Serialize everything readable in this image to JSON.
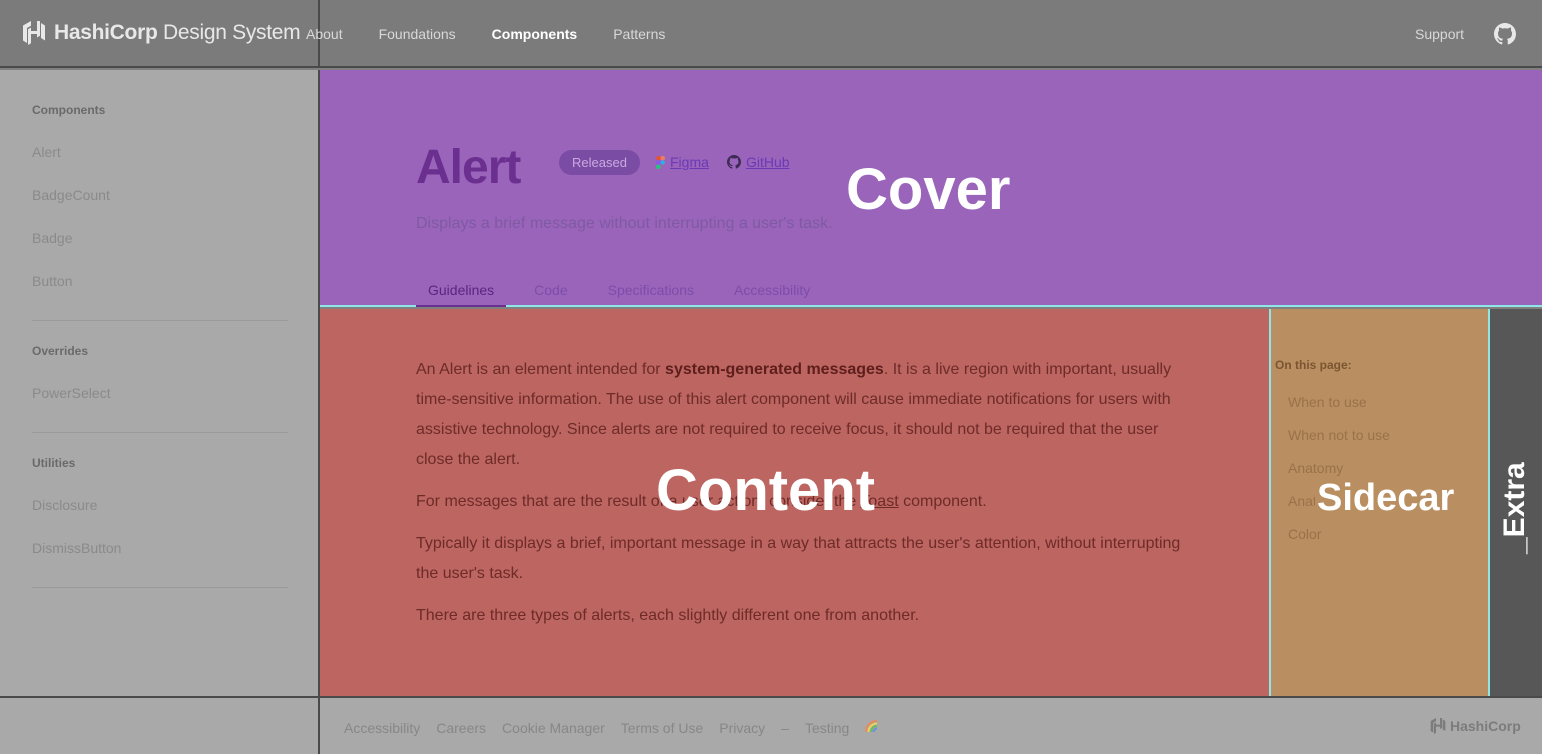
{
  "header": {
    "logo_brand": "HashiCorp",
    "logo_product": "Design System",
    "nav": [
      "About",
      "Foundations",
      "Components",
      "Patterns"
    ],
    "nav_active": "Components",
    "support": "Support"
  },
  "sidebar": {
    "sections": [
      {
        "title": "Components",
        "items": [
          "Alert",
          "BadgeCount",
          "Badge",
          "Button"
        ]
      },
      {
        "title": "Overrides",
        "items": [
          "PowerSelect"
        ]
      },
      {
        "title": "Utilities",
        "items": [
          "Disclosure",
          "DismissButton"
        ]
      }
    ]
  },
  "cover": {
    "title": "Alert",
    "badge": "Released",
    "figma": "Figma",
    "github": "GitHub",
    "subtitle": "Displays a brief message without interrupting a user's task.",
    "tabs": [
      "Guidelines",
      "Code",
      "Specifications",
      "Accessibility"
    ],
    "active_tab": "Guidelines",
    "overlay_label": "Cover"
  },
  "content": {
    "p1_before": "An Alert is an element intended for ",
    "p1_bold": "system-generated messages",
    "p1_after": ". It is a live region with important, usually time-sensitive information. The use of this alert component will cause immediate notifications for users with assistive technology. Since alerts are not required to receive focus, it should not be required that the user close the alert.",
    "p2_before": "For messages that are the result of a user action, consider the ",
    "p2_link": "Toast",
    "p2_after": " component.",
    "p3": "Typically it displays a brief, important message in a way that attracts the user's attention, without interrupting the user's task.",
    "p4": "There are three types of alerts, each slightly different one from another.",
    "overlay_label": "Content"
  },
  "sidecar": {
    "title": "On this page:",
    "items": [
      "When to use",
      "When not to use",
      "Anatomy",
      "Anatomy",
      "Color"
    ],
    "overlay_label": "Sidecar"
  },
  "extra": {
    "overlay_label": "_Extra"
  },
  "footer": {
    "links": [
      "Accessibility",
      "Careers",
      "Cookie Manager",
      "Terms of Use",
      "Privacy",
      "–",
      "Testing"
    ],
    "brand": "HashiCorp"
  },
  "colors": {
    "cover": "#9a64bb",
    "content": "#bc6561",
    "sidecar": "#b98f62",
    "extra": "#575757",
    "header": "#7b7b7b",
    "sidebar": "#a9a9a9"
  }
}
